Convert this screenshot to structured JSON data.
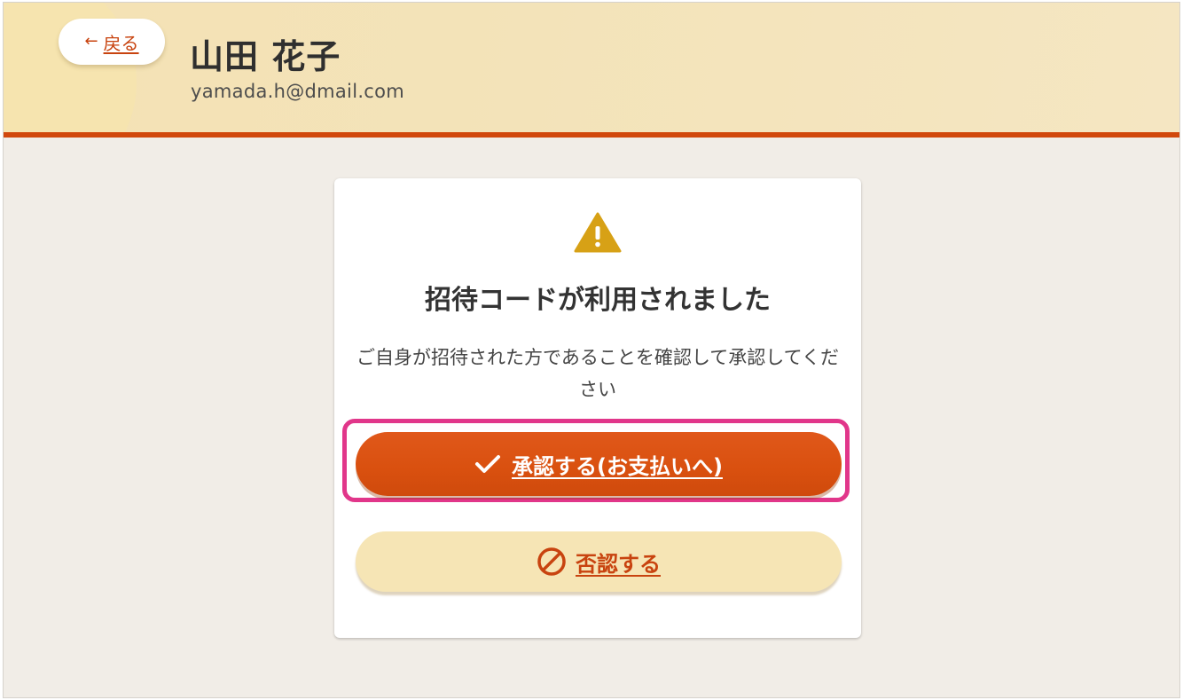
{
  "header": {
    "back_label": "戻る",
    "user_name": "山田 花子",
    "user_email": "yamada.h@dmail.com"
  },
  "dialog": {
    "icon": "warning-icon",
    "title": "招待コードが利用されました",
    "message": "ご自身が招待された方であることを確認して承認してください",
    "approve_label": "承認する(お支払いへ)",
    "reject_label": "否認する"
  },
  "colors": {
    "accent": "#d9500f",
    "highlight": "#e1368a",
    "warning": "#d7a116",
    "header_bg": "#f4e2b4"
  }
}
